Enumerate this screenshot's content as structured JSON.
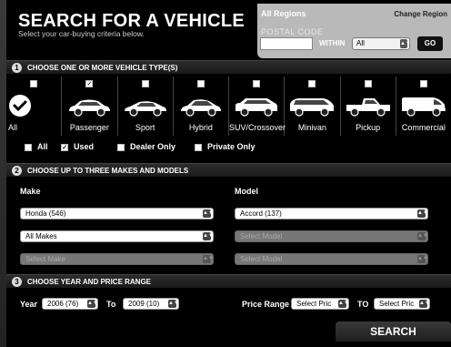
{
  "header": {
    "title": "SEARCH FOR A VEHICLE",
    "subtitle": "Select your car-buying criteria below."
  },
  "region": {
    "current": "All Regions",
    "change_label": "Change Region",
    "postal_label": "POSTAL CODE",
    "postal_value": "",
    "within_label": "WITHIN",
    "within_value": "All",
    "go_label": "GO"
  },
  "section1": {
    "num": "1",
    "label": "CHOOSE ONE OR MORE VEHICLE TYPE(S)"
  },
  "vehicle_types": [
    {
      "label": "All",
      "checked": true
    },
    {
      "label": "Passenger",
      "checked": true
    },
    {
      "label": "Sport",
      "checked": false
    },
    {
      "label": "Hybrid",
      "checked": false
    },
    {
      "label": "SUV/Crossover",
      "checked": false
    },
    {
      "label": "Minivan",
      "checked": false
    },
    {
      "label": "Pickup",
      "checked": false
    },
    {
      "label": "Commercial",
      "checked": false
    }
  ],
  "conditions": [
    {
      "label": "All",
      "checked": false
    },
    {
      "label": "Used",
      "checked": true
    },
    {
      "label": "Dealer Only",
      "checked": false
    },
    {
      "label": "Private Only",
      "checked": false
    }
  ],
  "section2": {
    "num": "2",
    "label": "CHOOSE UP TO THREE MAKES AND MODELS"
  },
  "makes_models": {
    "make_header": "Make",
    "model_header": "Model",
    "rows": [
      {
        "make": "Honda (546)",
        "model": "Accord (137)",
        "make_enabled": true,
        "model_enabled": true
      },
      {
        "make": "All Makes",
        "model": "Select Model",
        "make_enabled": true,
        "model_enabled": false
      },
      {
        "make": "Select Make",
        "model": "Select Model",
        "make_enabled": false,
        "model_enabled": false
      }
    ]
  },
  "section3": {
    "num": "3",
    "label": "CHOOSE YEAR AND PRICE RANGE"
  },
  "year": {
    "label": "Year",
    "from": "2006 (76)",
    "to_label": "To",
    "to": "2009 (10)"
  },
  "price": {
    "label": "Price Range",
    "from": "Select Pric",
    "to_label": "TO",
    "to": "Select Pric"
  },
  "search_label": "SEARCH"
}
